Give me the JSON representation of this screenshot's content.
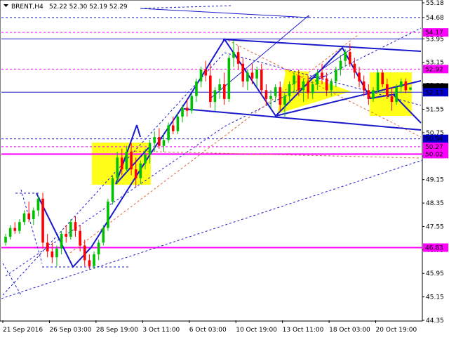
{
  "header": {
    "symbol": "BRENT,H4",
    "quote": "52.22 52.30 52.19 52.29"
  },
  "chart_data": {
    "type": "candlestick",
    "symbol": "BRENT",
    "timeframe": "H4",
    "ohlc_last": {
      "open": 52.22,
      "high": 52.3,
      "low": 52.19,
      "close": 52.29
    },
    "ylim": [
      44.35,
      55.18
    ],
    "y_ticks": [
      "55.18",
      "54.68",
      "53.95",
      "53.15",
      "52.36",
      "51.55",
      "50.75",
      "49.95",
      "49.15",
      "48.35",
      "47.55",
      "46.75",
      "45.95",
      "45.15",
      "44.35"
    ],
    "x_ticks": [
      "21 Sep 2016",
      "26 Sep 03:00",
      "28 Sep 19:00",
      "3 Oct 11:00",
      "6 Oct 03:00",
      "10 Oct 19:00",
      "13 Oct 11:00",
      "18 Oct 03:00",
      "20 Oct 19:00"
    ],
    "price_labels": [
      {
        "text": "54.17",
        "color": "#ff00ff"
      },
      {
        "text": "52.92",
        "color": "#ff00ff"
      },
      {
        "text": "52.29",
        "color": "#000000"
      },
      {
        "text": "52.13",
        "color": "#0000cc"
      },
      {
        "text": "50.54",
        "color": "#0000cc"
      },
      {
        "text": "50.27",
        "color": "#ff00ff"
      },
      {
        "text": "50.02",
        "color": "#ff00ff"
      },
      {
        "text": "46.83",
        "color": "#ff00ff"
      }
    ],
    "levels": {
      "magenta_solid": [
        50.02,
        46.83
      ],
      "magenta_dashed": [
        54.17,
        52.92,
        50.27
      ],
      "blue_solid": [
        53.95,
        52.13
      ],
      "blue_dashed": [
        54.68,
        50.54
      ]
    },
    "candles": [
      [
        47.0,
        47.3,
        46.9,
        47.2
      ],
      [
        47.2,
        47.6,
        47.1,
        47.5
      ],
      [
        47.5,
        47.7,
        47.3,
        47.4
      ],
      [
        47.4,
        47.8,
        47.3,
        47.7
      ],
      [
        47.7,
        48.1,
        47.6,
        48.0
      ],
      [
        48.0,
        48.4,
        47.7,
        47.8
      ],
      [
        47.8,
        48.2,
        47.6,
        48.1
      ],
      [
        48.1,
        48.6,
        47.9,
        48.5
      ],
      [
        48.5,
        48.7,
        46.8,
        47.0
      ],
      [
        47.0,
        47.3,
        46.5,
        46.7
      ],
      [
        46.7,
        47.0,
        46.3,
        46.5
      ],
      [
        46.5,
        46.9,
        46.2,
        46.8
      ],
      [
        46.8,
        47.4,
        46.6,
        47.3
      ],
      [
        47.3,
        47.6,
        47.0,
        47.2
      ],
      [
        47.2,
        47.8,
        47.1,
        47.7
      ],
      [
        47.7,
        47.9,
        47.2,
        47.4
      ],
      [
        47.4,
        47.6,
        46.7,
        46.9
      ],
      [
        46.9,
        47.1,
        46.2,
        46.4
      ],
      [
        46.4,
        46.6,
        46.1,
        46.2
      ],
      [
        46.2,
        46.7,
        46.1,
        46.6
      ],
      [
        46.6,
        47.1,
        46.4,
        47.0
      ],
      [
        47.0,
        47.6,
        46.9,
        47.5
      ],
      [
        47.5,
        48.5,
        47.4,
        48.4
      ],
      [
        48.4,
        49.3,
        48.3,
        49.2
      ],
      [
        49.2,
        50.1,
        49.0,
        49.9
      ],
      [
        49.9,
        50.2,
        49.3,
        49.5
      ],
      [
        49.5,
        50.3,
        49.4,
        50.1
      ],
      [
        50.1,
        50.4,
        49.3,
        49.5
      ],
      [
        49.5,
        49.9,
        48.9,
        49.2
      ],
      [
        49.2,
        49.8,
        49.0,
        49.7
      ],
      [
        49.7,
        50.2,
        49.5,
        50.0
      ],
      [
        50.0,
        50.5,
        49.7,
        50.4
      ],
      [
        50.4,
        50.8,
        50.1,
        50.6
      ],
      [
        50.6,
        50.9,
        50.2,
        50.3
      ],
      [
        50.3,
        50.7,
        50.1,
        50.5
      ],
      [
        50.5,
        51.1,
        50.4,
        51.0
      ],
      [
        51.0,
        51.3,
        50.7,
        50.8
      ],
      [
        50.8,
        51.4,
        50.7,
        51.3
      ],
      [
        51.3,
        51.7,
        51.1,
        51.6
      ],
      [
        51.6,
        51.9,
        51.3,
        51.5
      ],
      [
        51.5,
        52.1,
        51.4,
        52.0
      ],
      [
        52.0,
        52.6,
        51.8,
        52.5
      ],
      [
        52.5,
        53.0,
        52.3,
        52.9
      ],
      [
        52.9,
        53.2,
        52.5,
        52.7
      ],
      [
        52.7,
        53.1,
        51.6,
        51.8
      ],
      [
        51.8,
        52.3,
        51.5,
        52.2
      ],
      [
        52.2,
        52.6,
        51.9,
        52.4
      ],
      [
        52.4,
        52.8,
        51.7,
        51.9
      ],
      [
        51.9,
        53.4,
        51.8,
        53.3
      ],
      [
        53.3,
        53.9,
        53.0,
        53.5
      ],
      [
        53.5,
        53.7,
        52.9,
        53.1
      ],
      [
        53.1,
        53.3,
        52.3,
        52.5
      ],
      [
        52.5,
        52.9,
        52.2,
        52.8
      ],
      [
        52.8,
        53.1,
        52.4,
        52.6
      ],
      [
        52.6,
        53.0,
        52.3,
        52.9
      ],
      [
        52.9,
        53.1,
        52.0,
        52.2
      ],
      [
        52.2,
        52.4,
        51.7,
        51.9
      ],
      [
        51.9,
        52.2,
        51.6,
        52.0
      ],
      [
        52.0,
        52.4,
        51.8,
        52.3
      ],
      [
        52.3,
        52.5,
        51.5,
        51.7
      ],
      [
        51.7,
        52.1,
        51.3,
        52.0
      ],
      [
        52.0,
        52.5,
        51.8,
        52.4
      ],
      [
        52.4,
        52.8,
        52.1,
        52.7
      ],
      [
        52.7,
        52.9,
        52.0,
        52.2
      ],
      [
        52.2,
        52.6,
        51.8,
        52.5
      ],
      [
        52.5,
        52.7,
        51.9,
        52.1
      ],
      [
        52.1,
        52.5,
        51.9,
        52.4
      ],
      [
        52.4,
        52.9,
        52.2,
        52.8
      ],
      [
        52.8,
        53.1,
        52.4,
        52.6
      ],
      [
        52.6,
        52.8,
        52.0,
        52.2
      ],
      [
        52.2,
        52.6,
        52.0,
        52.5
      ],
      [
        52.5,
        53.0,
        52.3,
        52.9
      ],
      [
        52.9,
        53.4,
        52.7,
        53.2
      ],
      [
        53.2,
        53.6,
        53.0,
        53.5
      ],
      [
        53.5,
        53.8,
        53.0,
        53.1
      ],
      [
        53.1,
        53.3,
        52.6,
        52.8
      ],
      [
        52.8,
        53.0,
        52.3,
        52.5
      ],
      [
        52.5,
        52.7,
        52.0,
        52.2
      ],
      [
        52.2,
        52.4,
        51.7,
        51.9
      ],
      [
        51.9,
        52.3,
        51.8,
        52.2
      ],
      [
        52.2,
        52.9,
        52.1,
        52.8
      ],
      [
        52.8,
        52.9,
        52.3,
        52.4
      ],
      [
        52.4,
        52.6,
        51.9,
        52.0
      ],
      [
        52.0,
        52.3,
        51.5,
        51.8
      ],
      [
        51.8,
        52.4,
        51.7,
        52.3
      ],
      [
        52.3,
        52.6,
        52.1,
        52.5
      ],
      [
        52.5,
        52.6,
        52.1,
        52.2
      ],
      [
        52.22,
        52.3,
        52.19,
        52.29
      ]
    ]
  }
}
